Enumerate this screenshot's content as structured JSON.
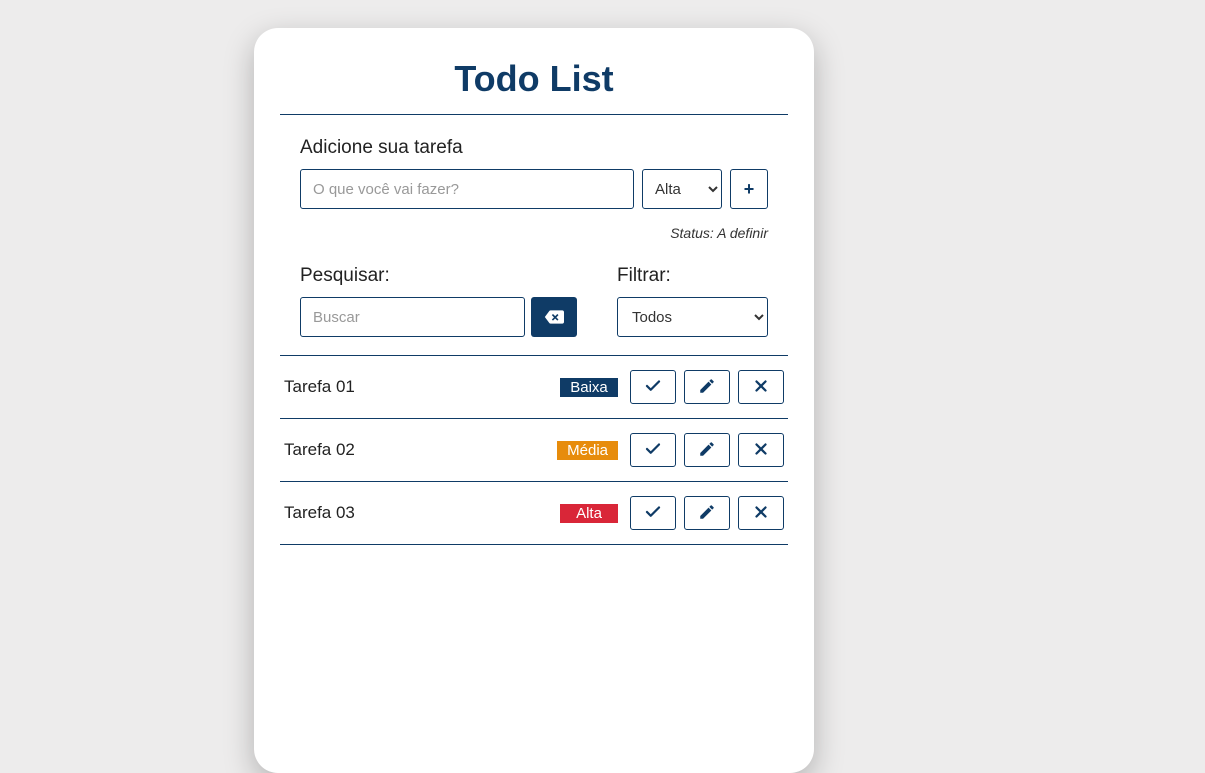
{
  "title": "Todo List",
  "add": {
    "label": "Adicione sua tarefa",
    "placeholder": "O que você vai fazer?",
    "priority_selected": "Alta",
    "status_text": "Status: A definir"
  },
  "search": {
    "label": "Pesquisar:",
    "placeholder": "Buscar"
  },
  "filter": {
    "label": "Filtrar:",
    "selected": "Todos"
  },
  "tasks": [
    {
      "title": "Tarefa 01",
      "priority": "Baixa",
      "priority_class": "baixa"
    },
    {
      "title": "Tarefa 02",
      "priority": "Média",
      "priority_class": "media"
    },
    {
      "title": "Tarefa 03",
      "priority": "Alta",
      "priority_class": "alta"
    }
  ]
}
